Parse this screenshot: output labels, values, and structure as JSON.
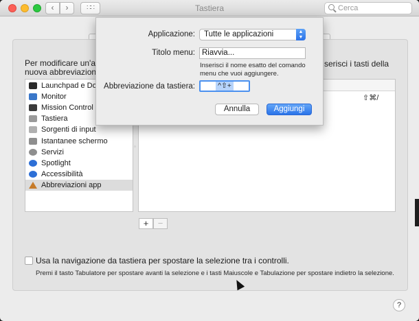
{
  "window": {
    "title": "Tastiera"
  },
  "search": {
    "placeholder": "Cerca"
  },
  "toolbar": {
    "back": "‹",
    "forward": "›",
    "grid": "∷∷"
  },
  "intro": {
    "left": "Per modificare un'abb nuova abbreviazione.",
    "right": "serisci i tasti della"
  },
  "list": {
    "items": [
      {
        "label": "Launchpad e Dock",
        "icon": "launchpad-icon",
        "color": "#2b2b2b"
      },
      {
        "label": "Monitor",
        "icon": "monitor-icon",
        "color": "#3a77c9"
      },
      {
        "label": "Mission Control",
        "icon": "mission-control-icon",
        "color": "#3b3b3b"
      },
      {
        "label": "Tastiera",
        "icon": "keyboard-icon",
        "color": "#9a9a9a"
      },
      {
        "label": "Sorgenti di input",
        "icon": "input-sources-icon",
        "color": "#b0b0b0"
      },
      {
        "label": "Istantanee schermo",
        "icon": "screenshot-icon",
        "color": "#8e8e8e"
      },
      {
        "label": "Servizi",
        "icon": "gear-icon",
        "color": "#8e8e8e"
      },
      {
        "label": "Spotlight",
        "icon": "spotlight-icon",
        "color": "#2d6fd6"
      },
      {
        "label": "Accessibilità",
        "icon": "accessibility-icon",
        "color": "#2d6fd6"
      },
      {
        "label": "Abbreviazioni app",
        "icon": "app-shortcuts-icon",
        "color": "#c67b2a"
      }
    ],
    "selected_index": 9
  },
  "table": {
    "shortcut": "⇧⌘/"
  },
  "buttons": {
    "plus": "+",
    "minus": "−",
    "help": "?"
  },
  "options": {
    "keyboard_nav_label": "Usa la navigazione da tastiera per spostare la selezione tra i controlli.",
    "keyboard_nav_checked": false,
    "hint": "Premi il tasto Tabulatore per spostare avanti la selezione e i tasti Maiuscole e Tabulazione per spostare indietro la selezione."
  },
  "sheet": {
    "app_label": "Applicazione:",
    "app_value": "Tutte le applicazioni",
    "menu_label": "Titolo menu:",
    "menu_value": "Riavvia...",
    "help_text": "Inserisci il nome esatto del comando menu che vuoi aggiungere.",
    "shortcut_label": "Abbreviazione da tastiera:",
    "shortcut_value": "^⇧+",
    "cancel": "Annulla",
    "add": "Aggiungi"
  }
}
